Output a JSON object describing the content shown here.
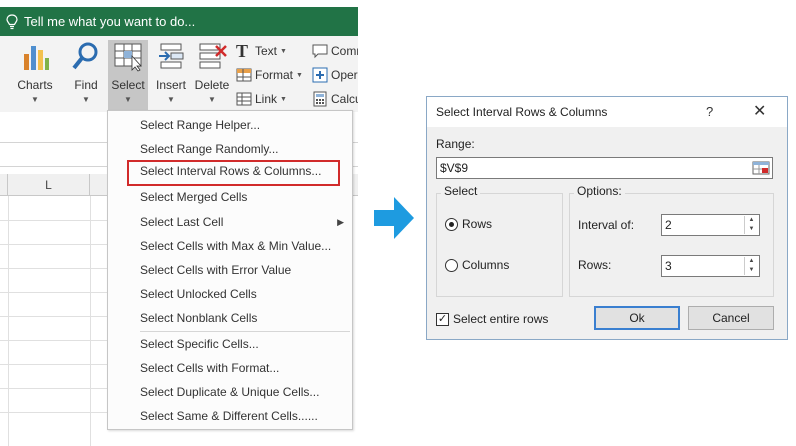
{
  "excel": {
    "tell_me": "Tell me what you want to do...",
    "ribbon": {
      "charts": "Charts",
      "find": "Find",
      "select": "Select",
      "insert": "Insert",
      "delete": "Delete",
      "text": "Text",
      "format": "Format",
      "link": "Link",
      "comm": "Comm",
      "opera": "Opera",
      "calcu": "Calcu"
    },
    "column_header": "L",
    "menu_items": [
      "Select Range Helper...",
      "Select Range Randomly...",
      "Select Interval Rows & Columns...",
      "Select Merged Cells",
      "Select Last Cell",
      "Select Cells with Max & Min Value...",
      "Select Cells with Error Value",
      "Select Unlocked Cells",
      "Select Nonblank Cells",
      "Select Specific Cells...",
      "Select Cells with Format...",
      "Select Duplicate & Unique Cells...",
      "Select Same & Different Cells......"
    ]
  },
  "dialog": {
    "title": "Select Interval Rows & Columns",
    "help": "?",
    "close": "✕",
    "range_label": "Range:",
    "range_value": "$V$9",
    "select_group": "Select",
    "rows_option": "Rows",
    "columns_option": "Columns",
    "options_group": "Options:",
    "interval_label": "Interval of:",
    "interval_value": "2",
    "rows_label": "Rows:",
    "rows_value": "3",
    "select_entire_rows": "Select entire rows",
    "ok": "Ok",
    "cancel": "Cancel"
  },
  "colors": {
    "excel_green": "#217346",
    "highlight_red": "#d12b2b",
    "arrow_blue": "#1e9be0"
  }
}
